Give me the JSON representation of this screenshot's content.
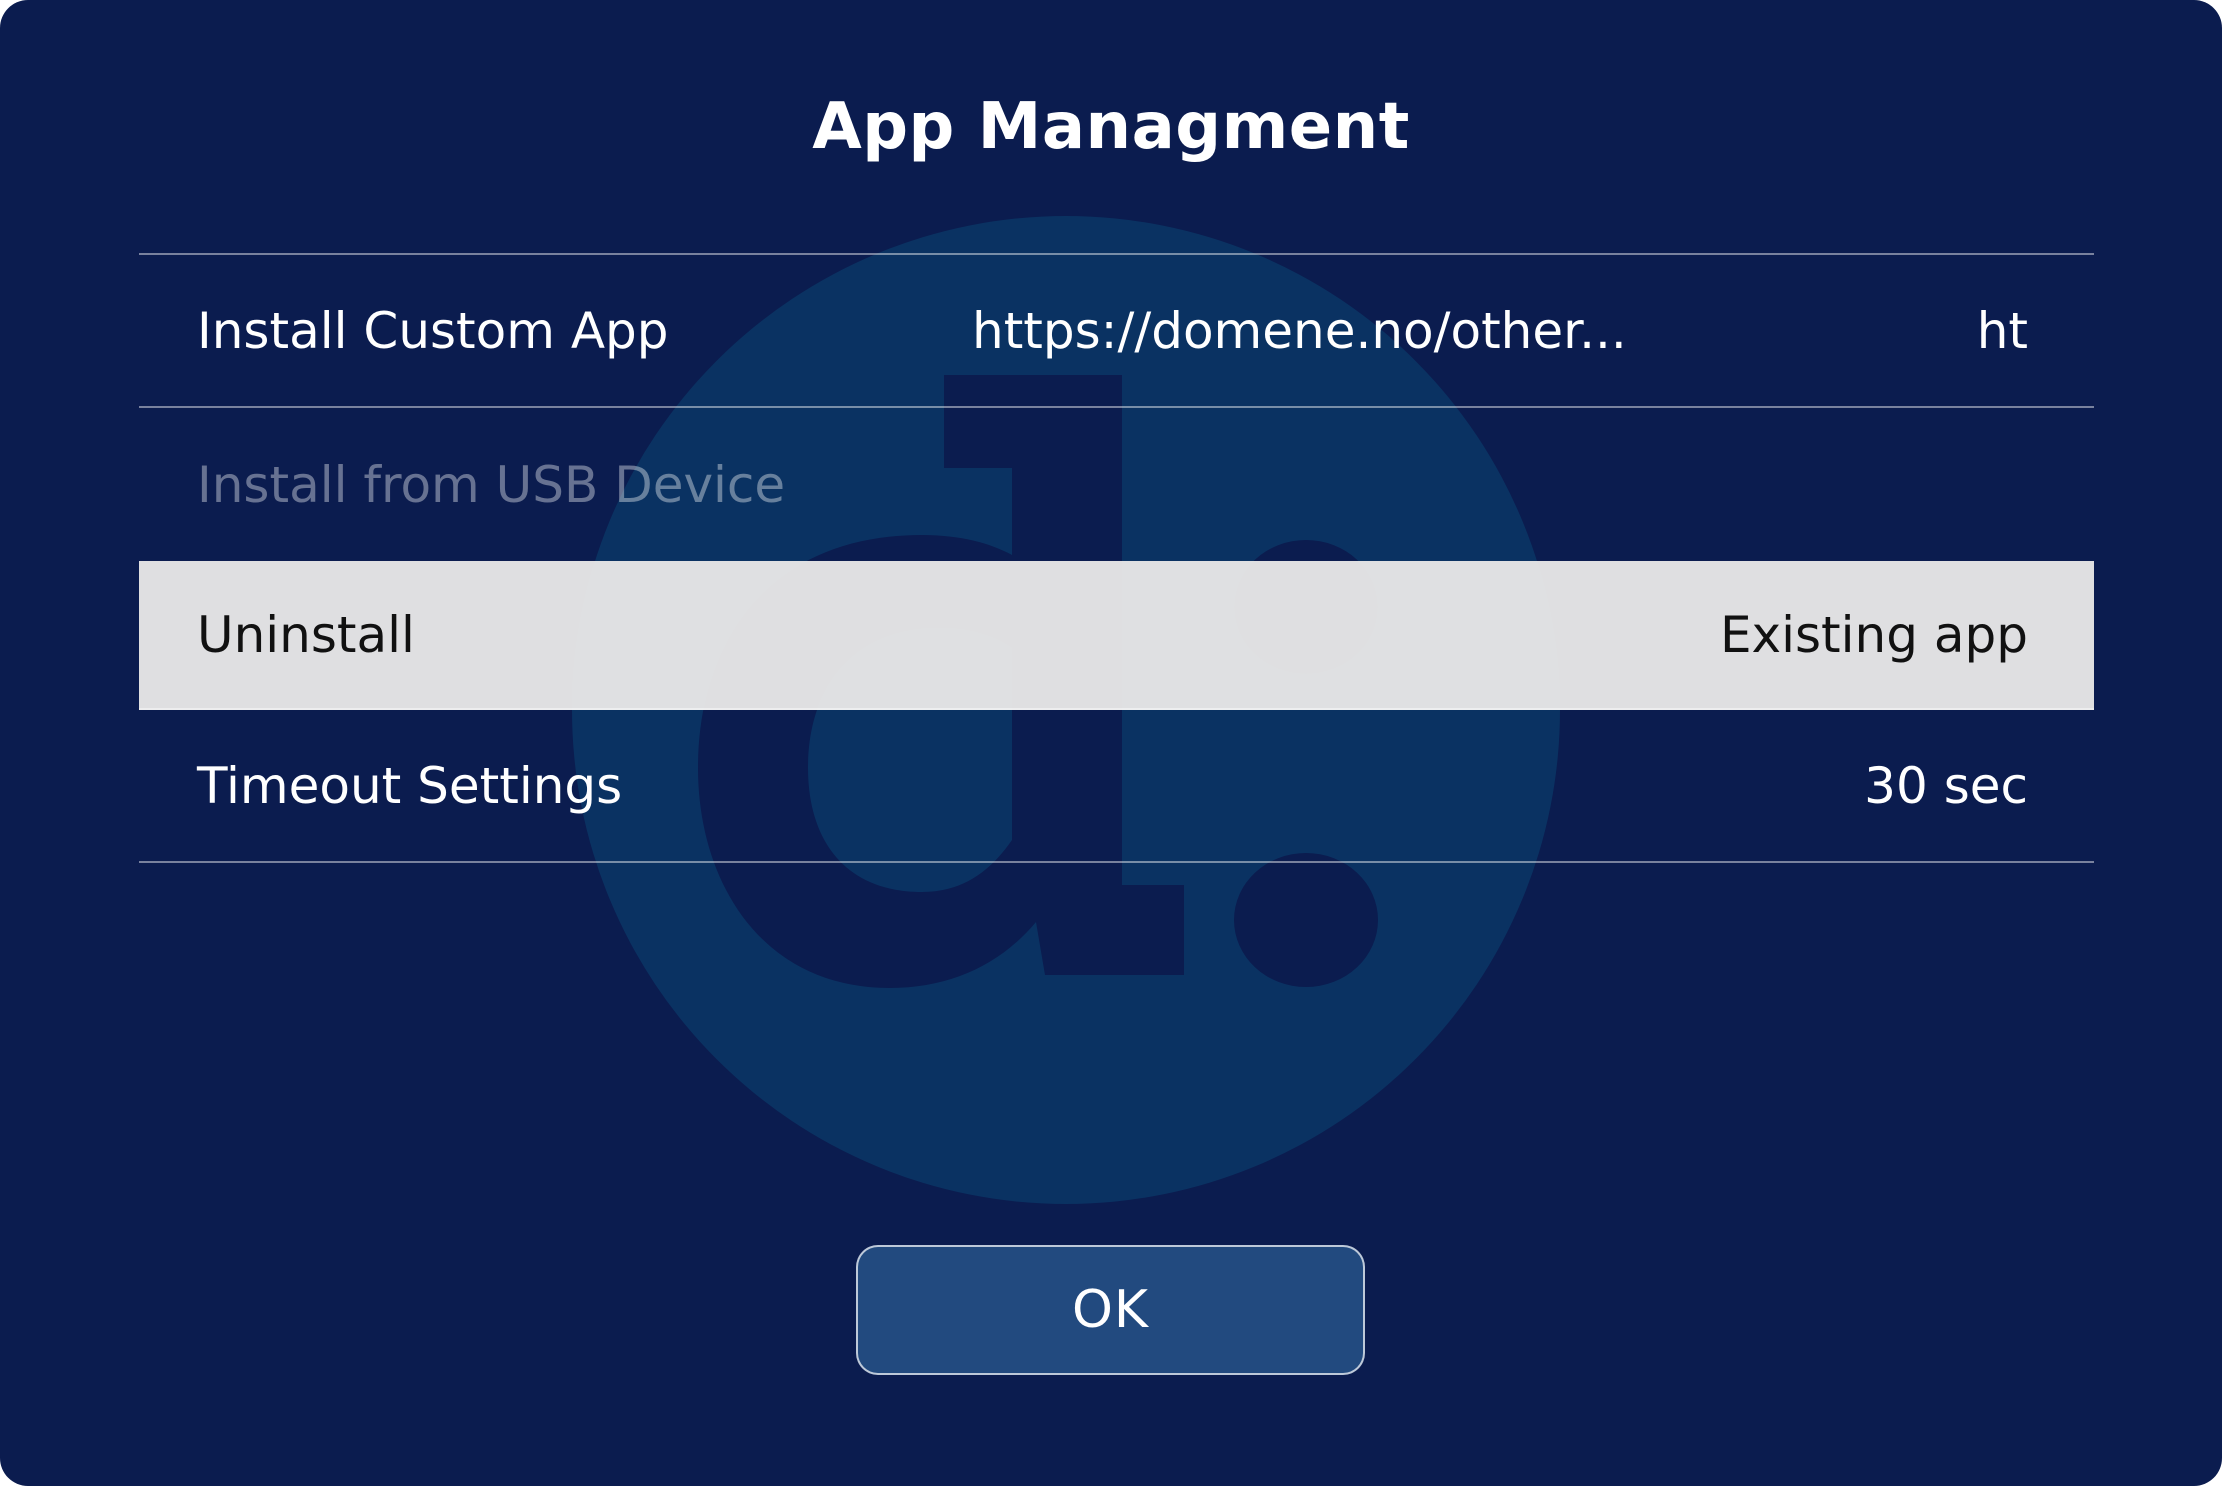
{
  "dialog": {
    "title": "App Managment",
    "ok_label": "OK"
  },
  "menu": {
    "items": [
      {
        "label": "Install Custom App",
        "value_mid": "https://domene.no/other...",
        "value_right": "ht",
        "state": "normal"
      },
      {
        "label": "Install from USB Device",
        "value_right": "",
        "state": "disabled"
      },
      {
        "label": "Uninstall",
        "value_right": "Existing app",
        "state": "selected"
      },
      {
        "label": "Timeout Settings",
        "value_right": "30 sec",
        "state": "normal"
      }
    ]
  },
  "colors": {
    "background": "#0b1c4f",
    "watermark_circle": "#0a3262",
    "selected_row": "#e6e6e6",
    "ok_button": "#224a7f"
  },
  "icons": {
    "watermark": "brand-logo-icon"
  }
}
